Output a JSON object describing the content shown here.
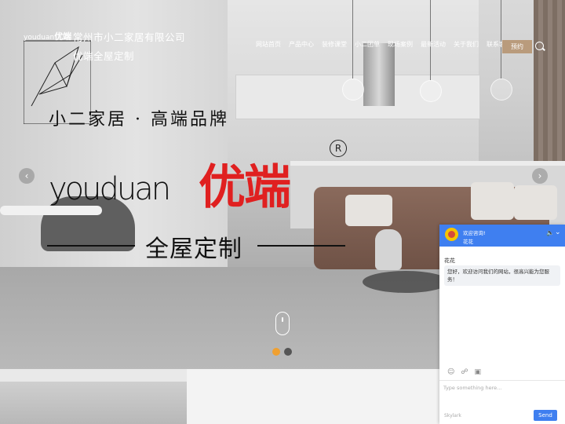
{
  "header": {
    "logo_latin": "youduan",
    "logo_cn": "优端",
    "company_name": "常州市小二家居有限公司",
    "slogan": "优端全屋定制"
  },
  "nav": {
    "items": [
      "网站首页",
      "产品中心",
      "装修课堂",
      "小二团单",
      "现场案例",
      "最新活动",
      "关于我们",
      "联系客服"
    ],
    "reserve_label": "预约",
    "search_icon": "search-icon"
  },
  "hero": {
    "tagline": "小二家居 · 高端品牌",
    "brand_latin": "youduan",
    "brand_cn": "优端",
    "registered_mark": "R",
    "sub_tagline": "全屋定制",
    "prev_icon": "chevron-left-icon",
    "next_icon": "chevron-right-icon",
    "slides": [
      {
        "active": true
      },
      {
        "active": false
      }
    ],
    "colors": {
      "brand_red": "#e02020",
      "dot_active": "#f0a030",
      "dot_inactive": "#555555"
    }
  },
  "chat": {
    "title": "欢迎咨询!",
    "agent_name_header": "花花",
    "agent_name": "花花",
    "greeting": "您好，欢迎访问我们的网站，很高兴能为您服务！",
    "input_placeholder": "Type something here...",
    "powered_by": "Skylark",
    "send_label": "Send",
    "header_color": "#3f7ff0"
  }
}
